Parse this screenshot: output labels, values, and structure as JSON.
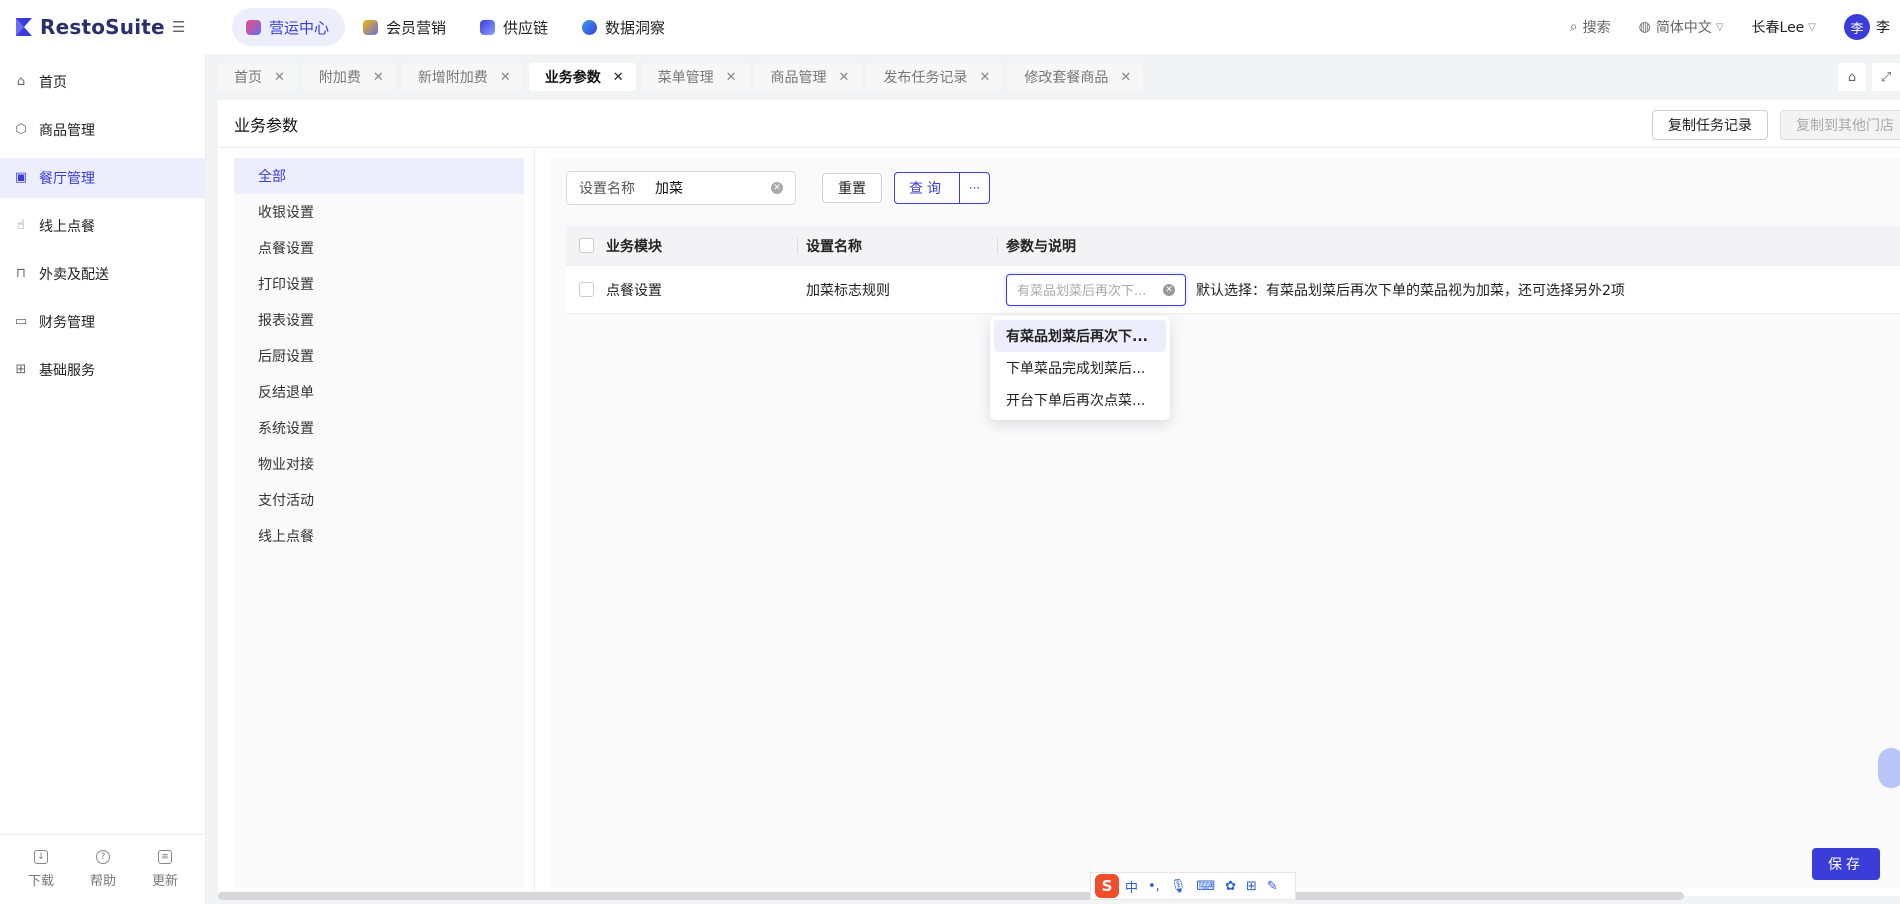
{
  "brand": {
    "name": "RestoSuite",
    "color": "#3a3dd8"
  },
  "modules": [
    {
      "label": "营运中心",
      "icon": "ops-icon",
      "active": true
    },
    {
      "label": "会员营销",
      "icon": "member-icon",
      "active": false
    },
    {
      "label": "供应链",
      "icon": "supply-icon",
      "active": false
    },
    {
      "label": "数据洞察",
      "icon": "data-icon",
      "active": false
    }
  ],
  "header": {
    "search_label": "搜索",
    "language": "简体中文",
    "store": "长春Lee",
    "user_avatar": "李",
    "user_name": "李"
  },
  "sidebar": {
    "items": [
      {
        "label": "首页",
        "icon": "home-icon"
      },
      {
        "label": "商品管理",
        "icon": "box-icon"
      },
      {
        "label": "餐厅管理",
        "icon": "store-icon",
        "active": true
      },
      {
        "label": "线上点餐",
        "icon": "hand-icon"
      },
      {
        "label": "外卖及配送",
        "icon": "bag-icon"
      },
      {
        "label": "财务管理",
        "icon": "folder-icon"
      },
      {
        "label": "基础服务",
        "icon": "grid-icon"
      }
    ],
    "bottom": {
      "download": "下载",
      "help": "帮助",
      "update": "更新"
    }
  },
  "tabs": [
    {
      "label": "首页"
    },
    {
      "label": "附加费"
    },
    {
      "label": "新增附加费"
    },
    {
      "label": "业务参数",
      "active": true
    },
    {
      "label": "菜单管理"
    },
    {
      "label": "商品管理"
    },
    {
      "label": "发布任务记录"
    },
    {
      "label": "修改套餐商品"
    }
  ],
  "page": {
    "title": "业务参数",
    "copy_task_label": "复制任务记录",
    "copy_store_label": "复制到其他门店"
  },
  "categories": [
    "全部",
    "收银设置",
    "点餐设置",
    "打印设置",
    "报表设置",
    "后厨设置",
    "反结退单",
    "系统设置",
    "物业对接",
    "支付活动",
    "线上点餐"
  ],
  "filter": {
    "label": "设置名称",
    "value": "加菜",
    "reset_label": "重置",
    "query_label": "查询",
    "more_label": "···"
  },
  "table": {
    "columns": [
      "业务模块",
      "设置名称",
      "参数与说明"
    ],
    "rows": [
      {
        "module": "点餐设置",
        "name": "加菜标志规则",
        "param_placeholder": "有菜品划菜后再次下...",
        "description": "默认选择：有菜品划菜后再次下单的菜品视为加菜，还可选择另外2项"
      }
    ]
  },
  "dropdown": {
    "options": [
      "有菜品划菜后再次下...",
      "下单菜品完成划菜后...",
      "开台下单后再次点菜..."
    ],
    "selected_index": 0
  },
  "save_label": "保存",
  "ime": {
    "logo": "S",
    "mode": "中"
  }
}
